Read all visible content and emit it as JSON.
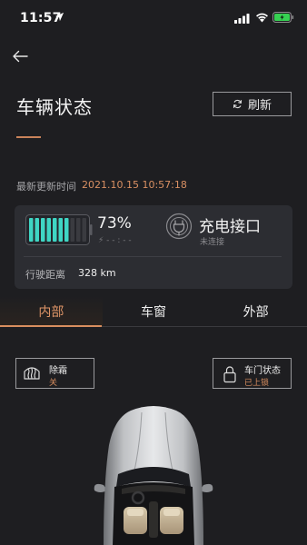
{
  "status_bar": {
    "time": "11:57"
  },
  "header": {
    "title": "车辆状态",
    "refresh_label": "刷新"
  },
  "update": {
    "label": "最新更新时间",
    "time": "2021.10.15 10:57:18"
  },
  "battery": {
    "percent_text": "73%",
    "level_fraction": 0.73,
    "charge_status": "⚡ - - : - -"
  },
  "charging_port": {
    "title": "充电接口",
    "status": "未连接"
  },
  "range": {
    "label": "行驶距离",
    "value": "328 km"
  },
  "tabs": [
    {
      "label": "内部",
      "active": true
    },
    {
      "label": "车窗",
      "active": false
    },
    {
      "label": "外部",
      "active": false
    }
  ],
  "controls": {
    "defrost": {
      "label": "除霜",
      "status": "关"
    },
    "door_lock": {
      "label": "车门状态",
      "status": "已上锁"
    }
  },
  "colors": {
    "accent": "#d98e5f",
    "battery_fill": "#3fd6c4",
    "background": "#1e1e21",
    "card": "#2c2d32"
  }
}
